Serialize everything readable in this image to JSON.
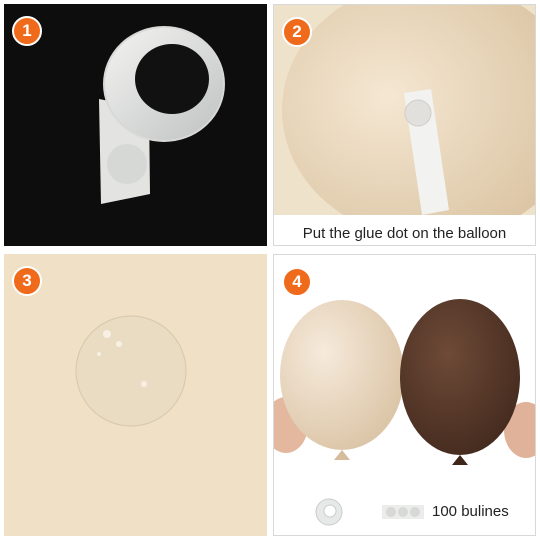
{
  "steps": [
    {
      "number": "1"
    },
    {
      "number": "2",
      "caption": "Put the glue dot on the balloon"
    },
    {
      "number": "3"
    },
    {
      "number": "4",
      "caption": "100 bulines"
    }
  ],
  "colors": {
    "badge": "#f06a1c",
    "panel1_bg": "#0d0d0d",
    "balloon_nude": "#e9d6b9",
    "balloon_brown": "#5a3b2c",
    "panel3_bg": "#efe0c6"
  }
}
